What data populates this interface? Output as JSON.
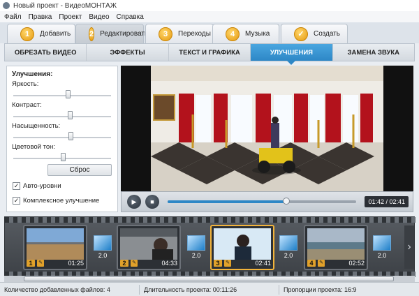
{
  "window": {
    "title": "Новый проект - ВидеоМОНТАЖ"
  },
  "menu": [
    "Файл",
    "Правка",
    "Проект",
    "Видео",
    "Справка"
  ],
  "steps": [
    {
      "num": "1",
      "label": "Добавить"
    },
    {
      "num": "2",
      "label": "Редактировать",
      "active": true
    },
    {
      "num": "3",
      "label": "Переходы"
    },
    {
      "num": "4",
      "label": "Музыка"
    },
    {
      "num": "✓",
      "label": "Создать"
    }
  ],
  "subtabs": [
    "ОБРЕЗАТЬ ВИДЕО",
    "ЭФФЕКТЫ",
    "ТЕКСТ И ГРАФИКА",
    "УЛУЧШЕНИЯ",
    "ЗАМЕНА ЗВУКА"
  ],
  "active_subtab": "УЛУЧШЕНИЯ",
  "enhancements": {
    "title": "Улучшения:",
    "sliders": [
      {
        "label": "Яркость:",
        "value": 0.55
      },
      {
        "label": "Контраст:",
        "value": 0.57
      },
      {
        "label": "Насыщенность:",
        "value": 0.58
      },
      {
        "label": "Цветовой тон:",
        "value": 0.5
      }
    ],
    "reset_label": "Сброс",
    "auto_levels": {
      "label": "Авто-уровни",
      "checked": true
    },
    "complex": {
      "label": "Комплексное улучшение",
      "checked": true
    }
  },
  "player": {
    "time": "01:42 / 02:41",
    "progress": 0.63
  },
  "clips": [
    {
      "index": "1",
      "duration": "01:25"
    },
    {
      "index": "2",
      "duration": "04:33"
    },
    {
      "index": "3",
      "duration": "02:41",
      "selected": true
    },
    {
      "index": "4",
      "duration": "02:52"
    }
  ],
  "transitions": [
    "2.0",
    "2.0",
    "2.0",
    "2.0"
  ],
  "status": {
    "files": "Количество добавленных файлов: 4",
    "duration": "Длительность проекта:   00:11:26",
    "aspect": "Пропорции проекта:   16:9"
  },
  "colors": {
    "accent": "#2d87c6",
    "step_badge": "#e59a10",
    "selection": "#f3b43b"
  }
}
